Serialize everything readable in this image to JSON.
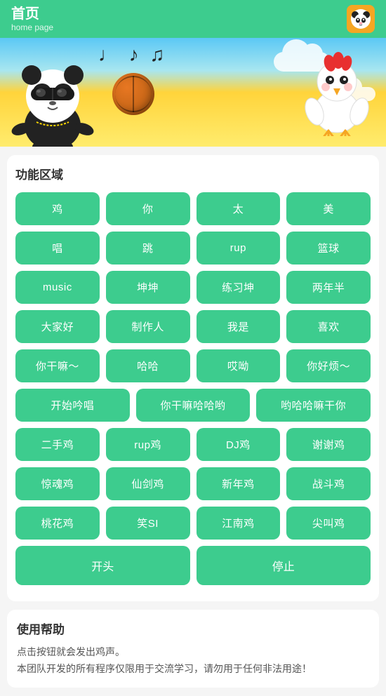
{
  "header": {
    "title_zh": "首页",
    "title_en": "home page",
    "avatar_label": "panda avatar"
  },
  "functions": {
    "section_title": "功能区域",
    "rows": [
      [
        "鸡",
        "你",
        "太",
        "美"
      ],
      [
        "唱",
        "跳",
        "rup",
        "篮球"
      ],
      [
        "music",
        "坤坤",
        "练习坤",
        "两年半"
      ],
      [
        "大家好",
        "制作人",
        "我是",
        "喜欢"
      ],
      [
        "你干嘛～",
        "哈哈",
        "哎呦",
        "你好烦～"
      ]
    ],
    "row_3": [
      "开始吟唱",
      "你干嘛哈哈哟",
      "哟哈哈嘛干你"
    ],
    "row_4": [
      "二手鸡",
      "rup鸡",
      "DJ鸡",
      "谢谢鸡"
    ],
    "row_5": [
      "惊魂鸡",
      "仙剑鸡",
      "新年鸡",
      "战斗鸡"
    ],
    "row_6": [
      "桃花鸡",
      "笑SI",
      "江南鸡",
      "尖叫鸡"
    ],
    "action_start": "开头",
    "action_stop": "停止"
  },
  "help": {
    "title": "使用帮助",
    "line1": "点击按钮就会发出鸡声。",
    "line2": "本团队开发的所有程序仅限用于交流学习，请勿用于任何非法用途！"
  }
}
